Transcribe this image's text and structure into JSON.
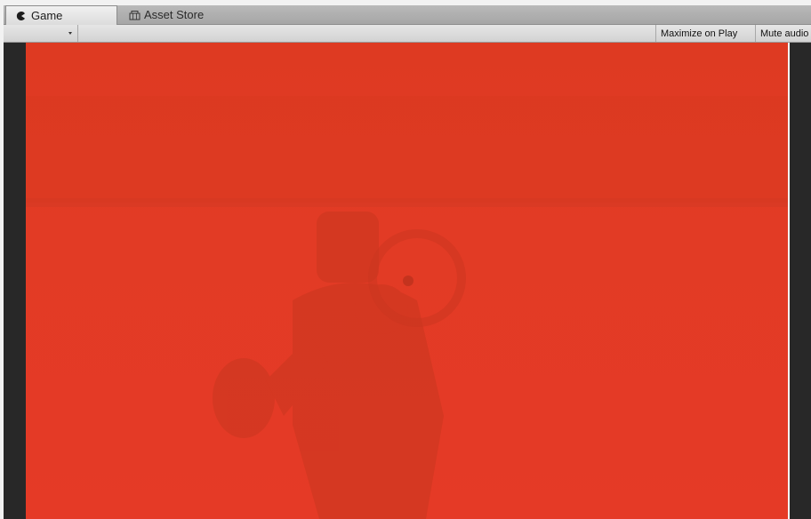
{
  "tabs": [
    {
      "label": "Game",
      "icon": "pacman-icon",
      "active": true
    },
    {
      "label": "Asset Store",
      "icon": "store-icon",
      "active": false
    }
  ],
  "toolbar": {
    "aspect_dropdown": "",
    "maximize_label": "Maximize on Play",
    "mute_label": "Mute audio"
  },
  "game_view": {
    "background_color": "#e23b25"
  }
}
